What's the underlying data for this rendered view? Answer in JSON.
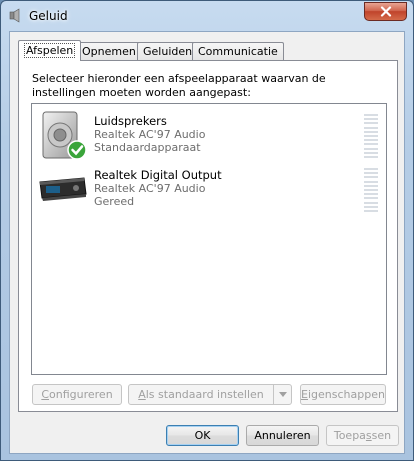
{
  "window": {
    "title": "Geluid"
  },
  "tabs": [
    {
      "label": "Afspelen",
      "active": true
    },
    {
      "label": "Opnemen",
      "active": false
    },
    {
      "label": "Geluiden",
      "active": false
    },
    {
      "label": "Communicatie",
      "active": false
    }
  ],
  "instruction": "Selecteer hieronder een afspeelapparaat waarvan de instellingen moeten worden aangepast:",
  "devices": [
    {
      "name": "Luidsprekers",
      "driver": "Realtek AC'97 Audio",
      "status": "Standaardapparaat",
      "icon": "speakers-icon",
      "default": true
    },
    {
      "name": "Realtek Digital Output",
      "driver": "Realtek AC'97 Audio",
      "status": "Gereed",
      "icon": "digital-output-icon",
      "default": false
    }
  ],
  "panel_buttons": {
    "configure": {
      "accel": "C",
      "rest": "onfigureren"
    },
    "set_default": {
      "accel": "A",
      "rest": "ls standaard instellen"
    },
    "properties": {
      "accel": "E",
      "rest": "igenschappen"
    }
  },
  "dialog_buttons": {
    "ok": "OK",
    "cancel": "Annuleren",
    "apply": {
      "before": "Toepa",
      "accel": "s",
      "after": "sen"
    }
  },
  "colors": {
    "titlebar": "#b5cde6",
    "close": "#c0432b",
    "disabled_text": "#a0a0a0"
  }
}
